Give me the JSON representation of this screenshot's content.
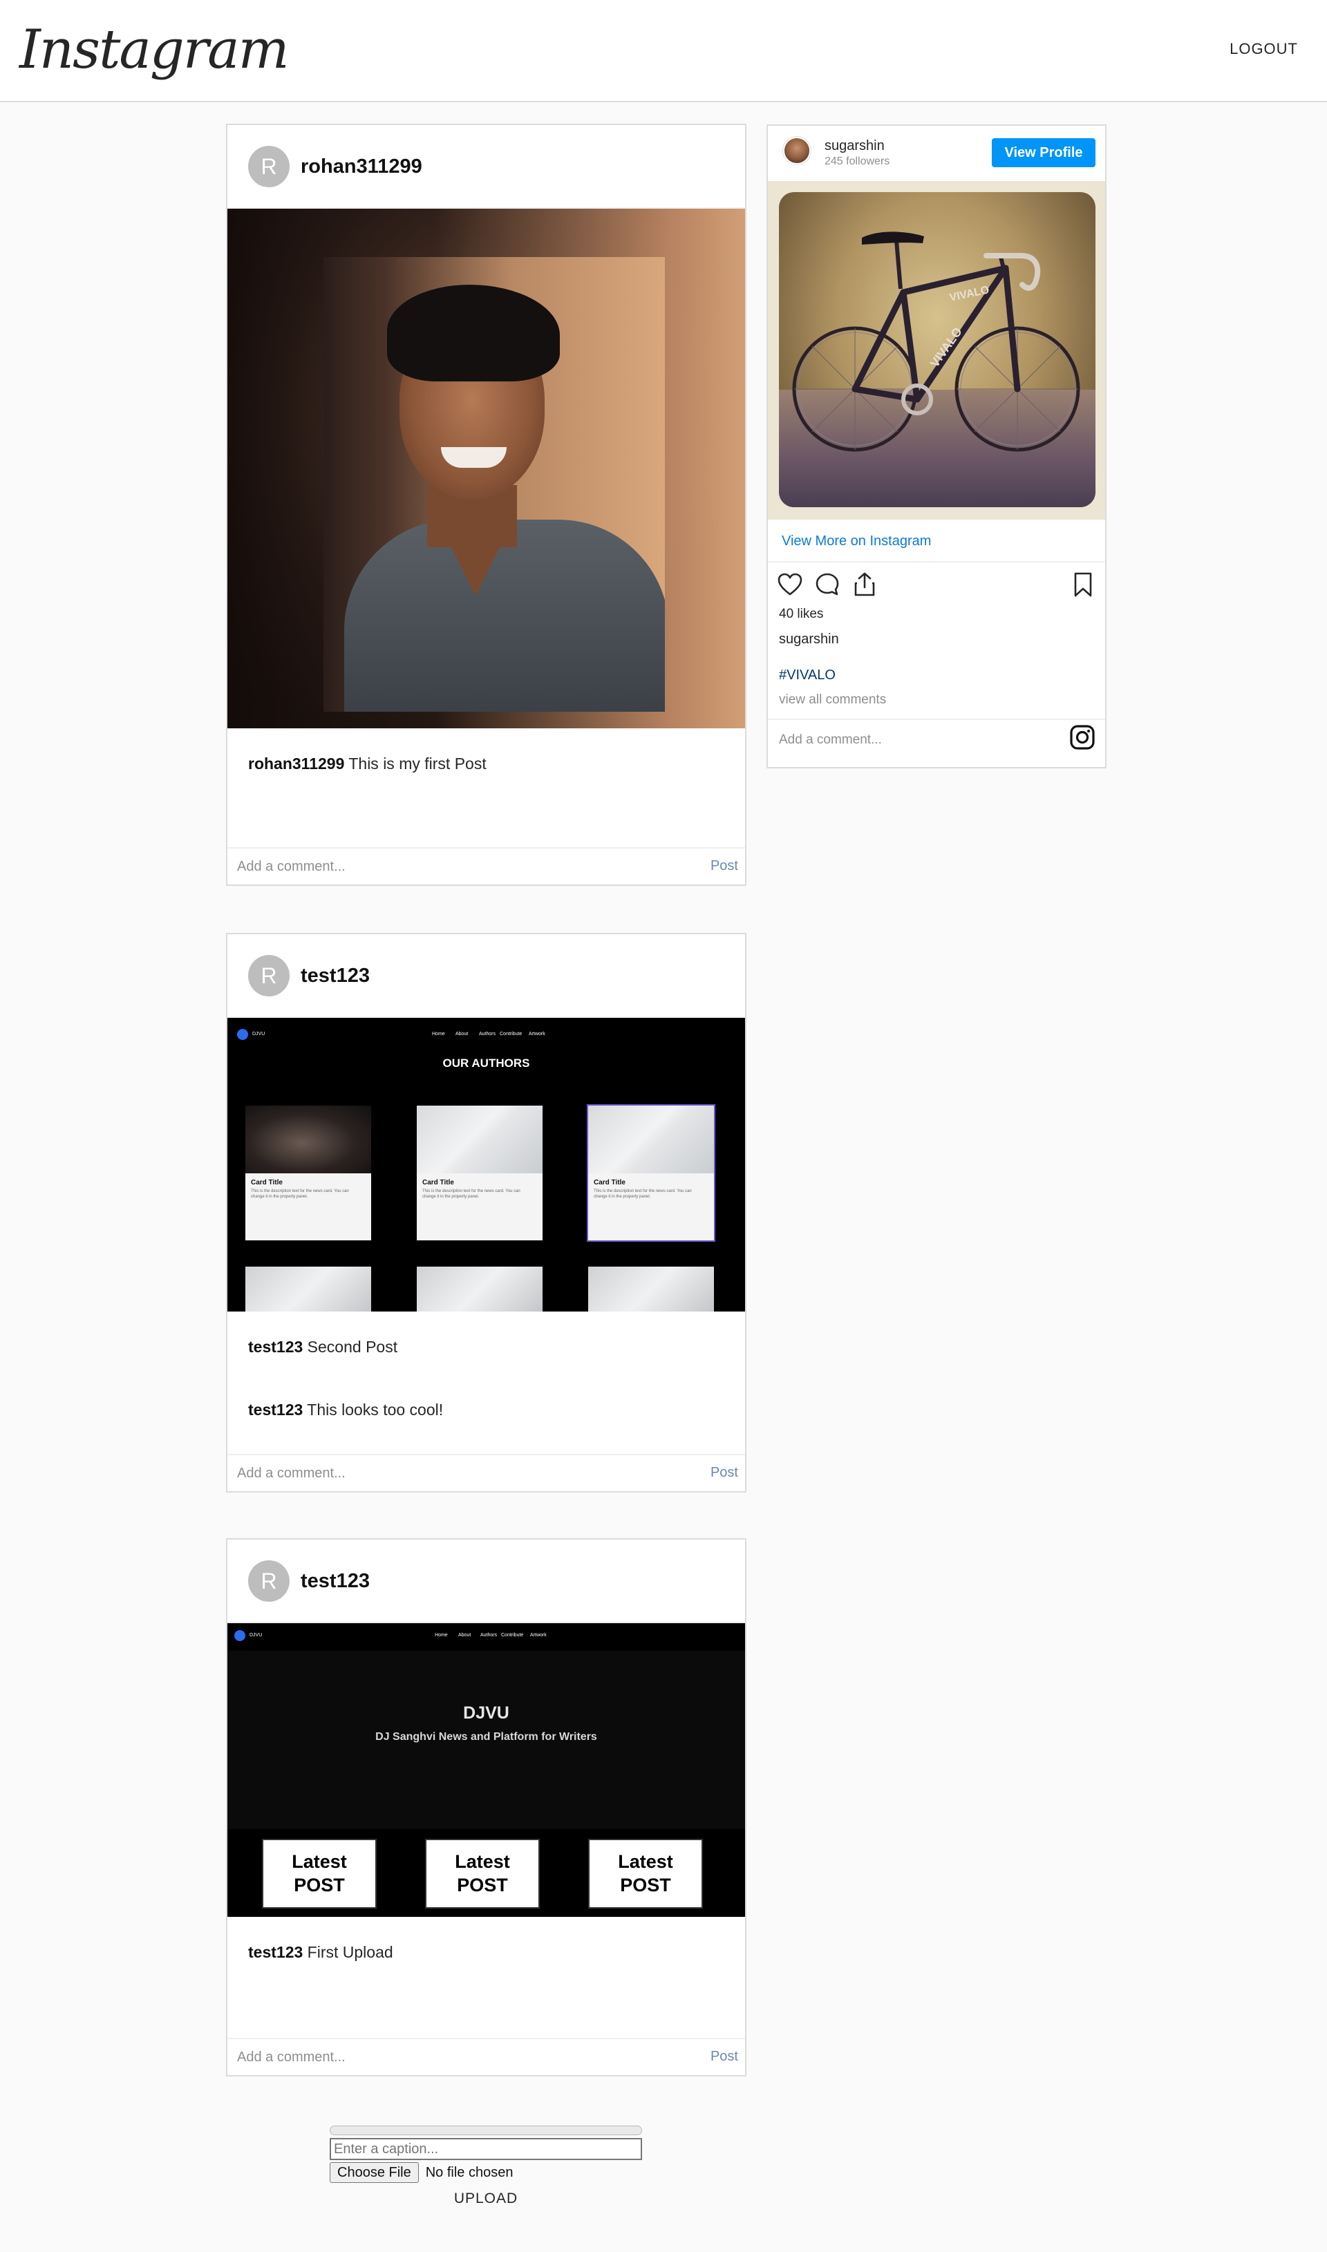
{
  "header": {
    "logo": "Instagram",
    "logout": "LOGOUT"
  },
  "posts": [
    {
      "avatar": "R",
      "username": "rohan311299",
      "captions": [
        {
          "user": "rohan311299",
          "text": "This is my first Post"
        }
      ],
      "comment_placeholder": "Add a comment...",
      "post_label": "Post"
    },
    {
      "avatar": "R",
      "username": "test123",
      "screenshot": {
        "brand": "DJVU",
        "nav": [
          "Home",
          "About",
          "Authors",
          "Contribute",
          "Artwork"
        ],
        "title": "OUR AUTHORS",
        "card_title": "Card Title",
        "card_text": "This is the description text for the news card. You can change it in the property panel."
      },
      "captions": [
        {
          "user": "test123",
          "text": "Second Post"
        },
        {
          "user": "test123",
          "text": "This looks too cool!"
        }
      ],
      "comment_placeholder": "Add a comment...",
      "post_label": "Post"
    },
    {
      "avatar": "R",
      "username": "test123",
      "screenshot": {
        "brand": "DJVU",
        "nav": [
          "Home",
          "About",
          "Authors",
          "Contribute",
          "Artwork"
        ],
        "hero_title": "DJVU",
        "hero_sub": "DJ Sanghvi News and Platform for Writers",
        "latest": [
          "Latest",
          "POST"
        ]
      },
      "captions": [
        {
          "user": "test123",
          "text": "First Upload"
        }
      ],
      "comment_placeholder": "Add a comment...",
      "post_label": "Post"
    }
  ],
  "widget": {
    "name": "sugarshin",
    "followers": "245 followers",
    "view_profile": "View Profile",
    "view_more": "View More on Instagram",
    "likes": "40 likes",
    "user": "sugarshin",
    "hashtag": "#VIVALO",
    "view_all": "view all comments",
    "comment_placeholder": "Add a comment...",
    "bike_label": "VIVALO",
    "icons": [
      "heart-icon",
      "comment-icon",
      "share-icon",
      "bookmark-icon",
      "instagram-icon"
    ]
  },
  "upload": {
    "caption_placeholder": "Enter a caption...",
    "choose_file": "Choose File",
    "no_file": "No file chosen",
    "upload_label": "UPLOAD"
  }
}
